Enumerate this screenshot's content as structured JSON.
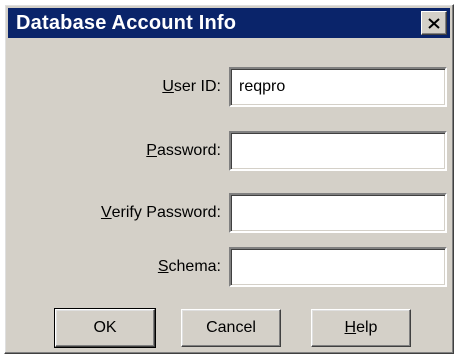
{
  "window": {
    "title": "Database Account Info",
    "close_icon": "close-icon"
  },
  "form": {
    "user_id": {
      "label_mnemonic": "U",
      "label_rest": "ser ID:",
      "value": "reqpro"
    },
    "password": {
      "label_mnemonic": "P",
      "label_rest": "assword:",
      "value": ""
    },
    "verify_password": {
      "label_mnemonic": "V",
      "label_rest": "erify Password:",
      "value": ""
    },
    "schema": {
      "label_mnemonic": "S",
      "label_rest": "chema:",
      "value": ""
    }
  },
  "buttons": {
    "ok_label": "OK",
    "cancel_label": "Cancel",
    "help_mnemonic": "H",
    "help_rest": "elp"
  },
  "colors": {
    "title_bar": "#0a246a",
    "dialog_face": "#d4d0c8"
  }
}
